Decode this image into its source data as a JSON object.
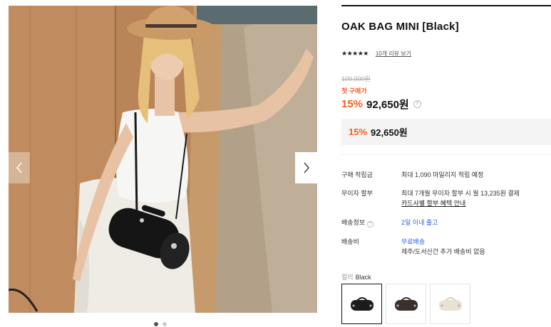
{
  "product": {
    "title": "OAK BAG MINI [Black]",
    "stars": "★★★★★",
    "review_link": "10개 리뷰 보기",
    "original_price": "109,000원",
    "first_purchase_label": "첫 구매가",
    "discount_percent": "15%",
    "sale_price": "92,650원",
    "help_icon": "?"
  },
  "price_box": {
    "discount_percent": "15%",
    "sale_price": "92,650원"
  },
  "details": {
    "points_label": "구매 적립금",
    "points_value": "최대 1,090 마일리지 적립 예정",
    "installment_label": "무이자 할부",
    "installment_value": "최대 7개월 무이자 할부 시 월 13,235원 결제",
    "installment_link": "카드사별 할부 혜택 안내",
    "shipping_info_label": "배송정보",
    "shipping_info_value": "2일 이내 출고",
    "shipping_fee_label": "배송비",
    "shipping_fee_value": "무료배송",
    "shipping_fee_note": "제주/도서산간 추가 배송비 없음"
  },
  "color": {
    "label": "컬러",
    "selected": "Black",
    "options": [
      "black",
      "brown",
      "cream"
    ]
  },
  "gallery": {
    "icons": {
      "prev": "chevron-left-icon",
      "next": "chevron-right-icon"
    }
  },
  "colors": {
    "accent": "#ff5a1f",
    "link_blue": "#2e63d8",
    "price_box_bg": "#f4f4f4"
  }
}
